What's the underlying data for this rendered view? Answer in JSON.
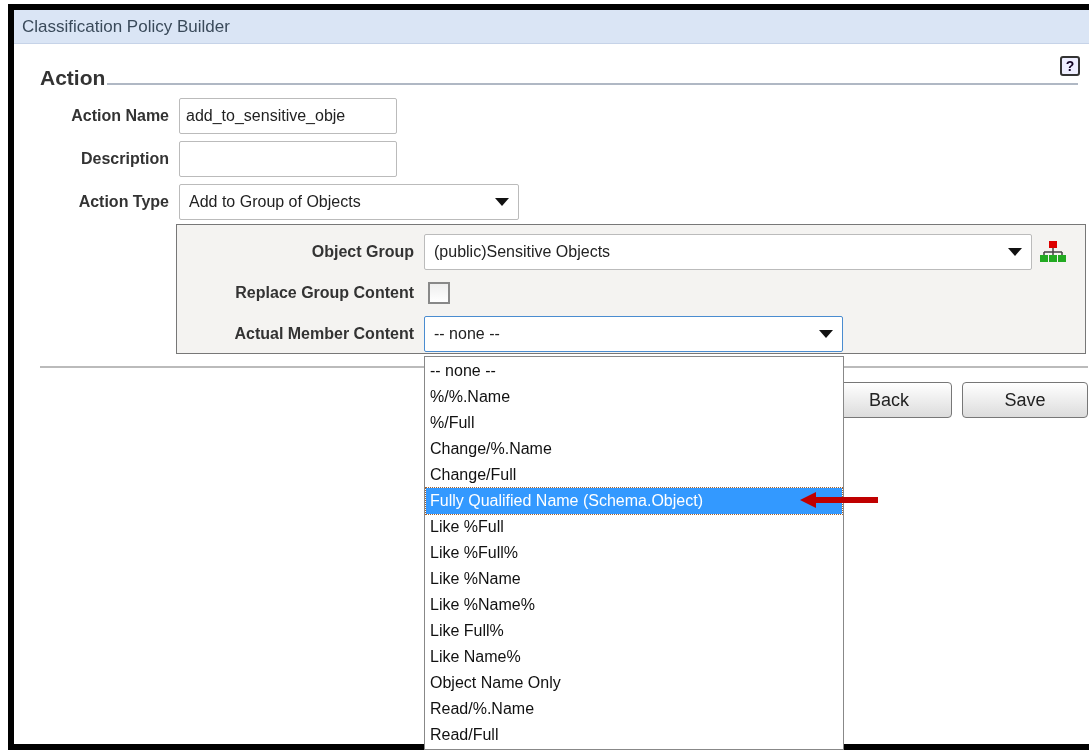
{
  "window": {
    "title": "Classification Policy Builder"
  },
  "section": {
    "legend": "Action",
    "help": "?"
  },
  "fields": [
    {
      "kind": "text",
      "label": "Action Name",
      "value": "add_to_sensitive_obje"
    },
    {
      "kind": "text",
      "label": "Description"
    },
    {
      "kind": "select",
      "label": "Action Type",
      "value": "Add to Group of Objects"
    }
  ],
  "subpanel": [
    {
      "kind": "select",
      "label": "Object Group",
      "value": "(public)Sensitive Objects"
    },
    {
      "kind": "checkbox",
      "label": "Replace Group Content",
      "checked": false
    },
    {
      "kind": "select",
      "label": "Actual Member Content",
      "value": "-- none --",
      "expanded": true
    }
  ],
  "dropdown_options": [
    {
      "label": "-- none --",
      "selected": false
    },
    {
      "label": "%/%.Name",
      "selected": false
    },
    {
      "label": "%/Full",
      "selected": false
    },
    {
      "label": "Change/%.Name",
      "selected": false
    },
    {
      "label": "Change/Full",
      "selected": false
    },
    {
      "label": "Fully Qualified Name (Schema.Object)",
      "selected": true
    },
    {
      "label": "Like %Full",
      "selected": false
    },
    {
      "label": "Like %Full%",
      "selected": false
    },
    {
      "label": "Like %Name",
      "selected": false
    },
    {
      "label": "Like %Name%",
      "selected": false
    },
    {
      "label": "Like Full%",
      "selected": false
    },
    {
      "label": "Like Name%",
      "selected": false
    },
    {
      "label": "Object Name Only",
      "selected": false
    },
    {
      "label": "Read/%.Name",
      "selected": false
    },
    {
      "label": "Read/Full",
      "selected": false
    }
  ],
  "buttons": [
    "Back",
    "Save"
  ]
}
